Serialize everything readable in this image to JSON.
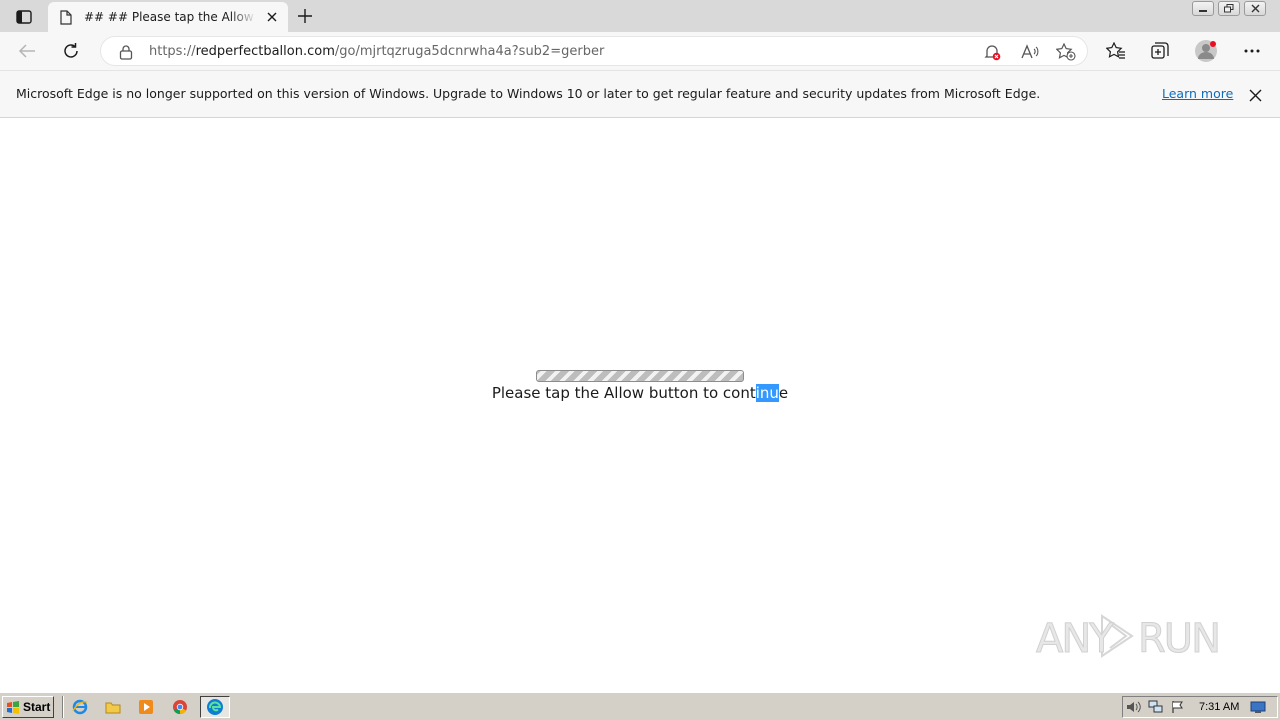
{
  "tab": {
    "title": "## ## Please tap the Allow button to continue"
  },
  "address": {
    "scheme": "https://",
    "host": "redperfectballon.com",
    "path": "/go/mjrtqzruga5dcnrwha4a?sub2=gerber"
  },
  "infobar": {
    "message": "Microsoft Edge is no longer supported on this version of Windows. Upgrade to Windows 10 or later to get regular feature and security updates from Microsoft Edge.",
    "learn_more": "Learn more"
  },
  "page": {
    "progress_fraction": 1.0,
    "prompt_before": "Please tap the Allow button to cont",
    "prompt_selected": "inu",
    "prompt_after": "e"
  },
  "watermark": {
    "text_left": "ANY",
    "text_right": "RUN"
  },
  "taskbar": {
    "start_label": "Start",
    "clock": "7:31 AM"
  },
  "colors": {
    "selection": "#3399ff",
    "link": "#0f6cbd",
    "notify_badge": "#e81123"
  },
  "icons": {
    "tab_actions": "tab-actions-icon",
    "page": "page-icon",
    "close": "close-icon",
    "new_tab": "plus-icon",
    "back": "back-arrow-icon",
    "refresh": "refresh-icon",
    "lock": "lock-icon",
    "notifications_blocked": "bell-blocked-icon",
    "read_aloud": "read-aloud-icon",
    "add_favorite": "star-plus-icon",
    "favorites": "favorites-icon",
    "collections": "collections-icon",
    "profile": "profile-icon",
    "more": "more-icon"
  }
}
